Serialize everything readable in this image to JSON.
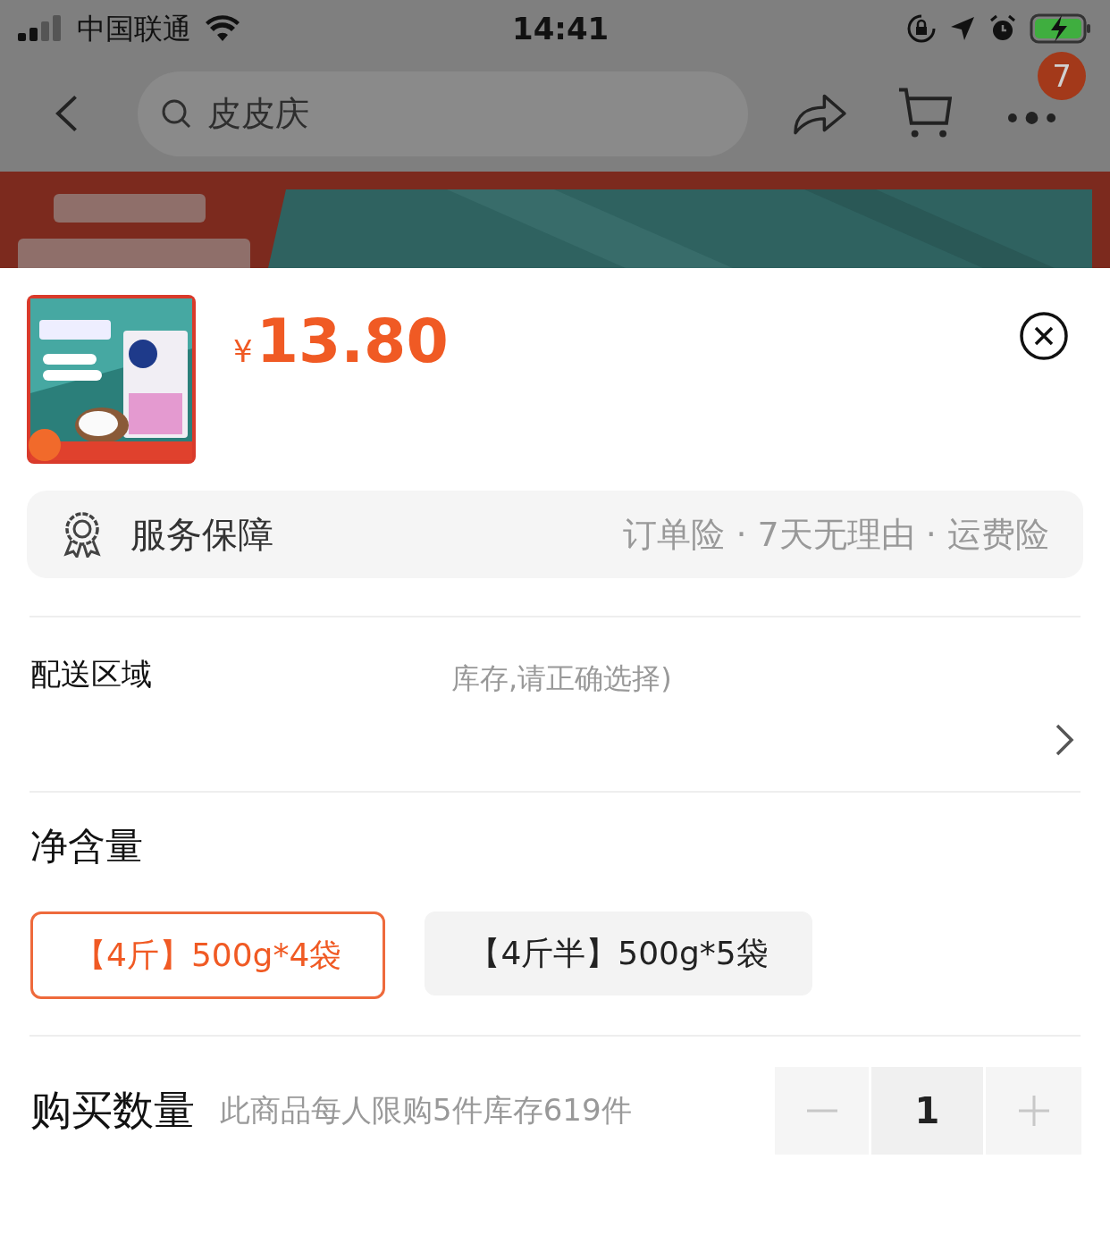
{
  "status_bar": {
    "carrier": "中国联通",
    "time": "14:41"
  },
  "nav": {
    "search": {
      "text": "皮皮庆"
    },
    "more_badge": "7"
  },
  "product": {
    "currency": "¥",
    "price": "13.80"
  },
  "service": {
    "label": "服务保障",
    "summary": "订单险 · 7天无理由 · 运费险"
  },
  "delivery": {
    "label": "配送区域",
    "note": "库存,请正确选择)"
  },
  "spec": {
    "title": "净含量",
    "options": [
      {
        "label": "【4斤】500g*4袋",
        "selected": true
      },
      {
        "label": "【4斤半】500g*5袋",
        "selected": false
      }
    ]
  },
  "quantity": {
    "label": "购买数量",
    "note": "此商品每人限购5件库存619件",
    "value": "1",
    "minus": {
      "disabled": true
    },
    "plus": {
      "disabled": true
    }
  }
}
